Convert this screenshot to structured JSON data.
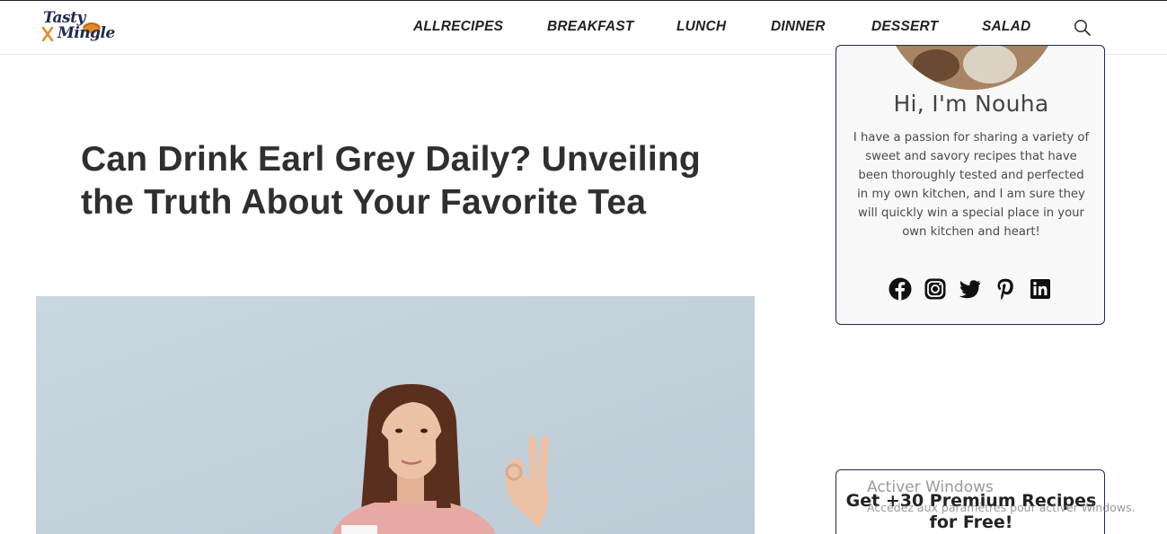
{
  "header": {
    "logo": {
      "line1": "Tasty",
      "line2": "Mingle"
    },
    "nav": [
      {
        "label": "ALLRECIPES"
      },
      {
        "label": "BREAKFAST"
      },
      {
        "label": "LUNCH"
      },
      {
        "label": "DINNER"
      },
      {
        "label": "DESSERT"
      },
      {
        "label": "SALAD"
      }
    ],
    "search_icon": "search-icon"
  },
  "article": {
    "title": "Can Drink Earl Grey Daily? Unveiling the Truth About Your Favorite Tea",
    "hero_image": "woman-holding-cup-ok-gesture"
  },
  "sidebar": {
    "about": {
      "greeting": "Hi, I'm Nouha",
      "text": "I have a passion for sharing a variety of sweet and savory recipes that have been thoroughly tested and perfected in my own kitchen, and I am sure they will quickly win a special place in your own kitchen and heart!",
      "social": [
        "facebook-icon",
        "instagram-icon",
        "twitter-icon",
        "pinterest-icon",
        "linkedin-icon"
      ]
    },
    "promo": {
      "title": "Get +30 Premium Recipes for Free!"
    }
  },
  "watermark": {
    "title": "Activer Windows",
    "subtitle": "Accédez aux paramètres pour activer Windows."
  },
  "colors": {
    "brand_navy": "#1d2a4d",
    "logo_orange": "#e28a2b",
    "text_dark": "#2f2f2f"
  }
}
